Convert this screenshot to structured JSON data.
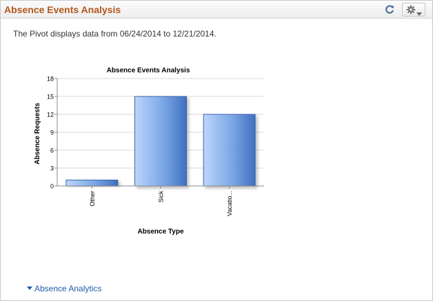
{
  "pagelet": {
    "title": "Absence Events Analysis",
    "refresh_icon": "refresh-icon",
    "actions_icon": "gear-icon"
  },
  "info_text": "The Pivot displays data from 06/24/2014 to 12/21/2014.",
  "chart_data": {
    "type": "bar",
    "title": "Absence Events Analysis",
    "xlabel": "Absence Type",
    "ylabel": "Absence Requests",
    "categories": [
      "Other",
      "Sick",
      "Vacatio..."
    ],
    "values": [
      1,
      15,
      12
    ],
    "ylim": [
      0,
      18
    ],
    "yticks": [
      "0",
      "3",
      "6",
      "9",
      "12",
      "15",
      "18"
    ],
    "grid": true,
    "legend": "none",
    "bar_color": "#6b9ce0"
  },
  "footer": {
    "link_label": "Absence Analytics",
    "link_icon": "triangle-down-icon"
  },
  "colors": {
    "title": "#b4561a",
    "link": "#1f5ba6"
  }
}
